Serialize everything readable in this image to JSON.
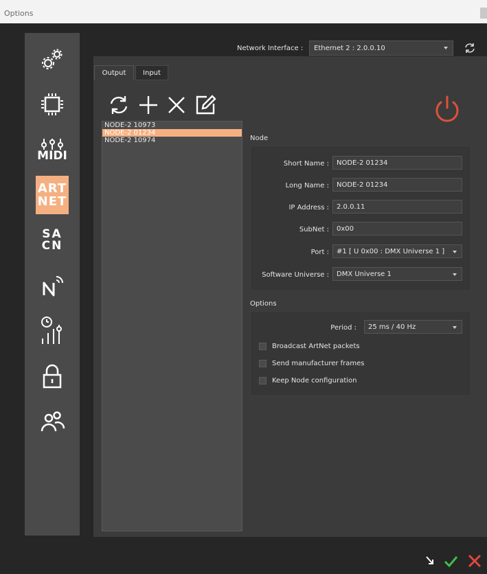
{
  "window": {
    "title": "Options"
  },
  "network": {
    "label": "Network Interface :",
    "selected": "Ethernet 2 : 2.0.0.10"
  },
  "sidebar": {
    "items": [
      {
        "name": "settings",
        "icon": "gears-icon"
      },
      {
        "name": "processor",
        "icon": "chip-icon"
      },
      {
        "name": "midi",
        "icon": "midi-icon",
        "label": "MIDI"
      },
      {
        "name": "artnet",
        "icon": "artnet-icon",
        "label_line1": "ART",
        "label_line2": "NET",
        "active": true
      },
      {
        "name": "sacn",
        "icon": "sacn-icon",
        "label_line1": "SA",
        "label_line2": "CN"
      },
      {
        "name": "network-wireless",
        "icon": "wireless-n-icon"
      },
      {
        "name": "timer-faders",
        "icon": "timer-faders-icon"
      },
      {
        "name": "lock",
        "icon": "lock-icon"
      },
      {
        "name": "users",
        "icon": "users-icon"
      }
    ]
  },
  "tabs": [
    {
      "label": "Output",
      "active": true
    },
    {
      "label": "Input",
      "active": false
    }
  ],
  "toolbar": {
    "icons": [
      "refresh-icon",
      "add-icon",
      "delete-icon",
      "edit-icon",
      "power-icon"
    ]
  },
  "nodes": [
    {
      "label": "NODE-2  10973",
      "selected": false
    },
    {
      "label": "NODE-2 01234",
      "selected": true
    },
    {
      "label": "NODE-2 10974",
      "selected": false
    }
  ],
  "node_section": {
    "title": "Node",
    "short_name_label": "Short Name :",
    "short_name_value": "NODE-2 01234",
    "long_name_label": "Long Name :",
    "long_name_value": "NODE-2 01234",
    "ip_label": "IP Address :",
    "ip_value": "2.0.0.11",
    "subnet_label": "SubNet :",
    "subnet_value": "0x00",
    "port_label": "Port :",
    "port_value": "#1 [ U 0x00 : DMX Universe 1 ]",
    "universe_label": "Software Universe :",
    "universe_value": "DMX Universe 1"
  },
  "options_section": {
    "title": "Options",
    "period_label": "Period :",
    "period_value": "25 ms / 40 Hz",
    "broadcast_label": "Broadcast ArtNet packets",
    "manufacturer_label": "Send manufacturer frames",
    "keep_label": "Keep Node configuration"
  },
  "colors": {
    "accent": "#f5b081",
    "power": "#e0503c",
    "ok": "#3dbf4a",
    "cancel": "#e3463a"
  }
}
